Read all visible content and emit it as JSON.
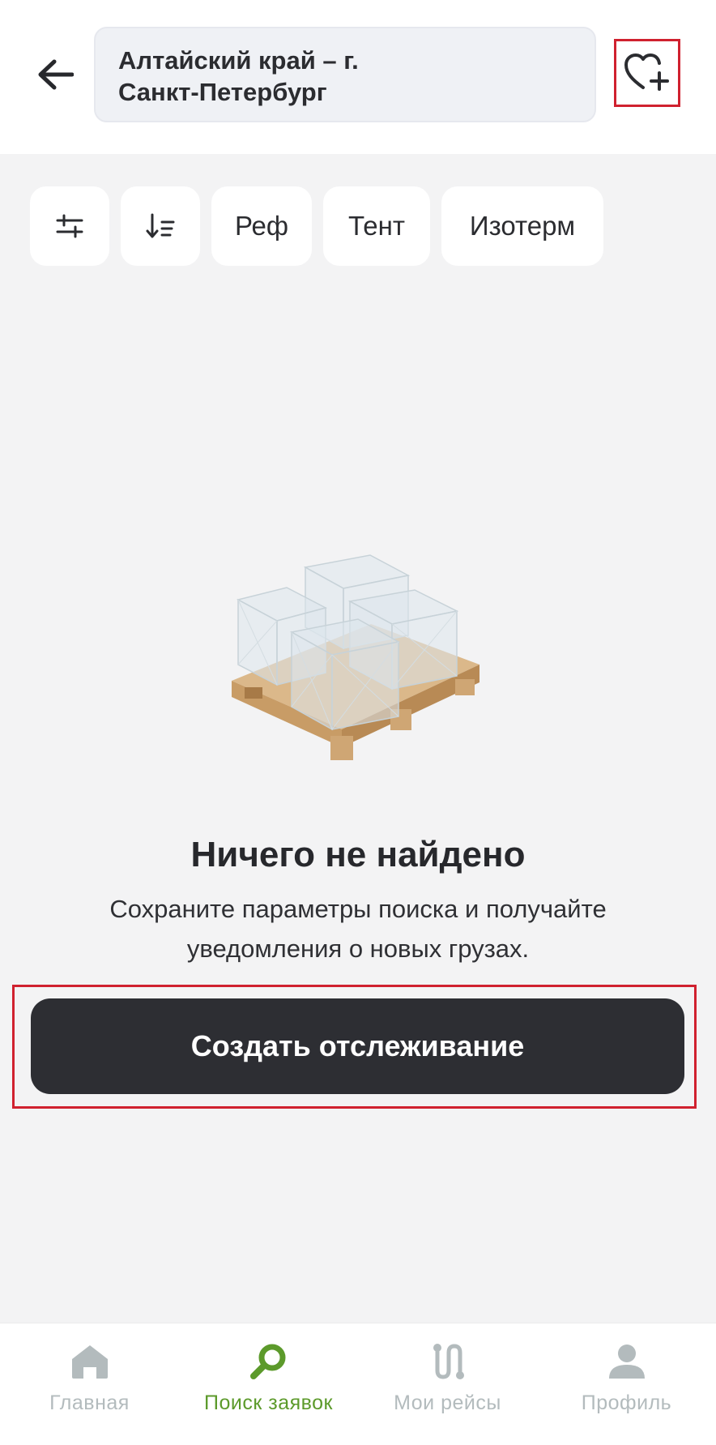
{
  "header": {
    "route_line1": "Алтайский край – г.",
    "route_line2": "Санкт-Петербург",
    "back_icon": "arrow-left-icon",
    "favorite_icon": "heart-plus-icon"
  },
  "filters": {
    "chips": [
      {
        "icon": "sliders-icon"
      },
      {
        "icon": "sort-icon"
      },
      {
        "label": "Реф"
      },
      {
        "label": "Тент"
      },
      {
        "label": "Изотерм"
      }
    ]
  },
  "empty_state": {
    "illustration": "pallet-boxes-illustration",
    "title": "Ничего не найдено",
    "desc_line1": "Сохраните параметры поиска и получайте",
    "desc_line2": "уведомления о новых грузах.",
    "cta_label": "Создать отслеживание"
  },
  "bottom_nav": {
    "items": [
      {
        "label": "Главная",
        "icon": "home-icon"
      },
      {
        "label": "Поиск заявок",
        "icon": "search-icon",
        "active": true
      },
      {
        "label": "Мои рейсы",
        "icon": "route-icon"
      },
      {
        "label": "Профиль",
        "icon": "user-icon"
      }
    ]
  },
  "colors": {
    "accent_green": "#5c9a2b",
    "highlight_red": "#d0212f",
    "cta_dark": "#2d2e33",
    "inactive_gray": "#b3bbbd"
  }
}
